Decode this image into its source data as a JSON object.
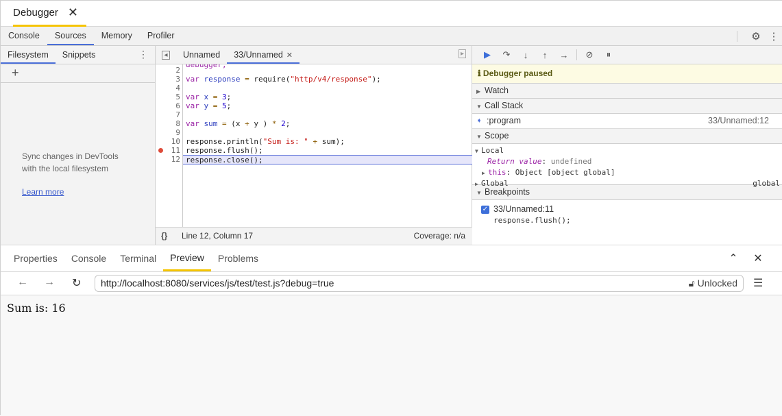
{
  "window": {
    "title": "Debugger",
    "close_label": "✕"
  },
  "devtools_tabs": [
    {
      "label": "Console"
    },
    {
      "label": "Sources",
      "active": true
    },
    {
      "label": "Memory"
    },
    {
      "label": "Profiler"
    }
  ],
  "navigator": {
    "tabs": [
      {
        "label": "Filesystem",
        "active": true
      },
      {
        "label": "Snippets"
      }
    ],
    "add_label": "+",
    "message_line1": "Sync changes in DevTools",
    "message_line2": "with the local filesystem",
    "learn_more": "Learn more"
  },
  "editor": {
    "tabs": [
      {
        "label": "Unnamed"
      },
      {
        "label": "33/Unnamed",
        "active": true,
        "closable": true
      }
    ],
    "breakpoint_line": 11,
    "current_line": 12,
    "status": {
      "format_label": "{}",
      "position": "Line 12, Column 17",
      "coverage": "Coverage: n/a"
    },
    "lines": [
      {
        "n": "2",
        "text": ""
      },
      {
        "n": "3",
        "text": "var response = require(\"http/v4/response\");"
      },
      {
        "n": "4",
        "text": ""
      },
      {
        "n": "5",
        "text": "var x = 3;"
      },
      {
        "n": "6",
        "text": "var y = 5;"
      },
      {
        "n": "7",
        "text": ""
      },
      {
        "n": "8",
        "text": "var sum = (x + y ) * 2;"
      },
      {
        "n": "9",
        "text": ""
      },
      {
        "n": "10",
        "text": "response.println(\"Sum is: \" + sum);"
      },
      {
        "n": "11",
        "text": "response.flush();"
      },
      {
        "n": "12",
        "text": "response.close();"
      }
    ]
  },
  "debugger": {
    "toolbar": [
      "resume",
      "step-over",
      "step-into",
      "step-out",
      "step",
      "deactivate-breakpoints",
      "pause-on-exceptions"
    ],
    "paused_message": "Debugger paused",
    "sections": {
      "watch": "Watch",
      "call_stack": "Call Stack",
      "scope": "Scope",
      "breakpoints": "Breakpoints"
    },
    "call_stack": [
      {
        "function": ":program",
        "location": "33/Unnamed:12"
      }
    ],
    "scope": {
      "local_label": "Local",
      "return_key": "Return value",
      "return_value": "undefined",
      "this_key": "this",
      "this_value": "Object [object global]",
      "global_label": "Global",
      "global_value": "global"
    },
    "breakpoints": [
      {
        "label": "33/Unnamed:11",
        "code": "response.flush();",
        "checked": true
      }
    ]
  },
  "bottom_panel": {
    "tabs": [
      {
        "label": "Properties"
      },
      {
        "label": "Console"
      },
      {
        "label": "Terminal"
      },
      {
        "label": "Preview",
        "active": true
      },
      {
        "label": "Problems"
      }
    ],
    "url": "http://localhost:8080/services/js/test/test.js?debug=true",
    "lock_label": "Unlocked",
    "output": "Sum is: 16"
  },
  "colors": {
    "accent": "#4a6ed8",
    "brand_yellow": "#f5c400",
    "breakpoint": "#de4b3a",
    "paused_bg": "#fdfbe3"
  }
}
